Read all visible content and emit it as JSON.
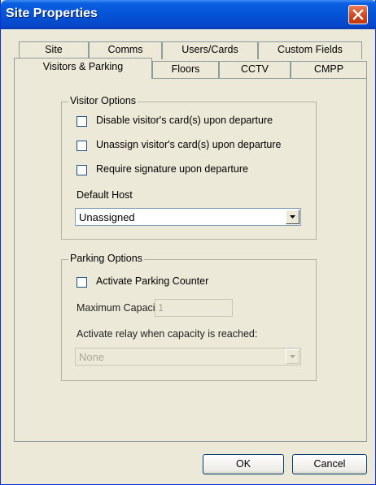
{
  "window": {
    "title": "Site Properties"
  },
  "tabs": {
    "row_back": [
      "Site",
      "Comms",
      "Users/Cards",
      "Custom Fields"
    ],
    "row_front": [
      "Visitors & Parking",
      "Floors",
      "CCTV",
      "CMPP"
    ],
    "active": "Visitors & Parking"
  },
  "visitor_options": {
    "legend": "Visitor Options",
    "disable_cards_label": "Disable visitor's card(s) upon departure",
    "unassign_cards_label": "Unassign visitor's card(s) upon departure",
    "require_signature_label": "Require signature upon departure",
    "default_host_label": "Default Host",
    "default_host_value": "Unassigned"
  },
  "parking_options": {
    "legend": "Parking Options",
    "activate_counter_label": "Activate Parking Counter",
    "max_capacity_label": "Maximum Capacity:",
    "max_capacity_value": "1",
    "relay_label": "Activate relay when capacity is reached:",
    "relay_value": "None"
  },
  "buttons": {
    "ok": "OK",
    "cancel": "Cancel"
  },
  "colors": {
    "titlebar": "#0553d6",
    "close": "#d0431a",
    "dialog_bg": "#ece9d8"
  }
}
